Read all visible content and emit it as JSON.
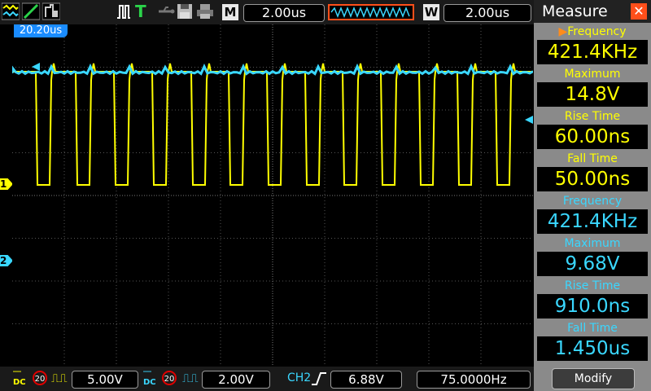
{
  "toolbar": {
    "icons": [
      "waveform-toggle-icon",
      "cursor-icon",
      "persist-icon",
      "trigger-pulse-icon",
      "trigger-type-icon",
      "usb-icon",
      "save-icon",
      "print-icon"
    ],
    "trigger_label": "T",
    "main_timebase_label": "M",
    "main_timebase": "2.00us",
    "window_label": "W",
    "window_timebase": "2.00us"
  },
  "screen": {
    "trigger_time_tag": "20.20us",
    "ch1_marker": "1",
    "ch2_marker": "2"
  },
  "measure": {
    "title": "Measure",
    "items": [
      {
        "label": "Frequency",
        "value": "421.4KHz",
        "channel": "CH1"
      },
      {
        "label": "Maximum",
        "value": "14.8V",
        "channel": "CH1"
      },
      {
        "label": "Rise Time",
        "value": "60.00ns",
        "channel": "CH1"
      },
      {
        "label": "Fall Time",
        "value": "50.00ns",
        "channel": "CH1"
      },
      {
        "label": "Frequency",
        "value": "421.4KHz",
        "channel": "CH2"
      },
      {
        "label": "Maximum",
        "value": "9.68V",
        "channel": "CH2"
      },
      {
        "label": "Rise Time",
        "value": "910.0ns",
        "channel": "CH2"
      },
      {
        "label": "Fall Time",
        "value": "1.450us",
        "channel": "CH2"
      }
    ],
    "modify_label": "Modify"
  },
  "status": {
    "ch1_bw": "20",
    "ch1_scale": "5.00V",
    "ch2_bw": "20",
    "ch2_scale": "2.00V",
    "trigger_source": "CH2",
    "trigger_level": "6.88V",
    "trigger_frequency": "75.0000Hz"
  },
  "colors": {
    "ch1": "#ffff00",
    "ch2": "#3ad7ff",
    "accent": "#ff4f1a",
    "grid": "#555555"
  }
}
